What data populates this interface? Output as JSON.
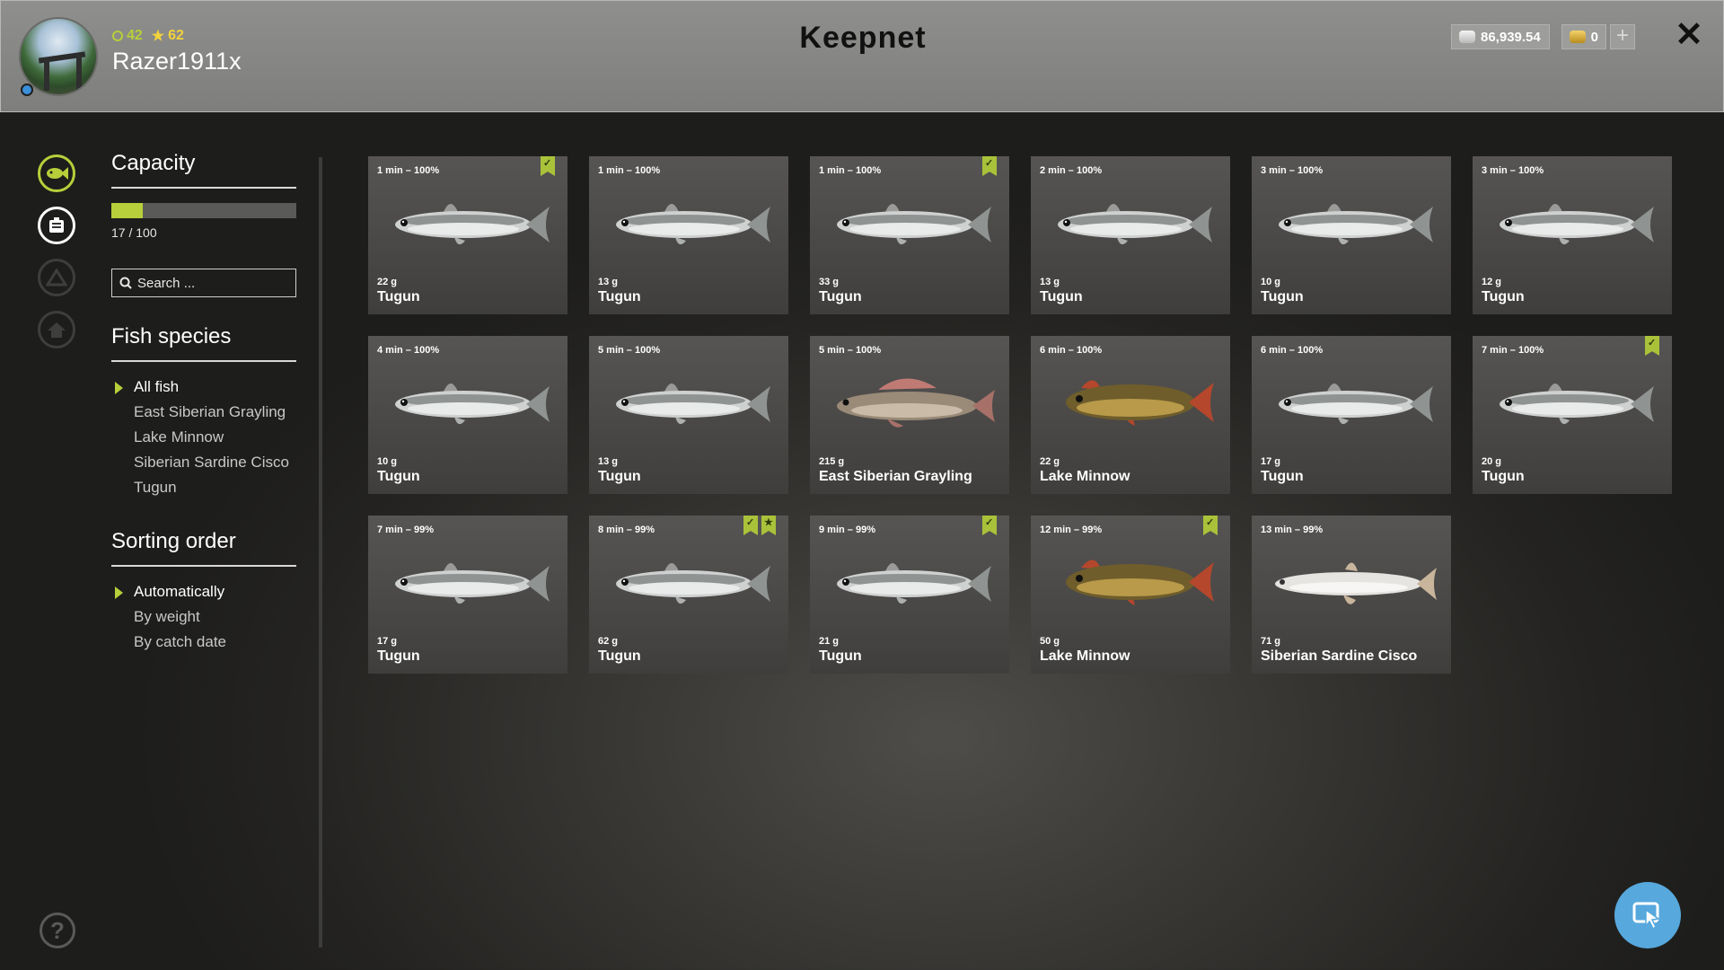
{
  "header": {
    "title": "Keepnet",
    "player": {
      "name": "Razer1911x",
      "level": "42",
      "rank": "62"
    },
    "currency": {
      "silver": "86,939.54",
      "gold": "0"
    },
    "plus_label": "+",
    "close_label": "✕"
  },
  "sidebar": {
    "capacity": {
      "title": "Capacity",
      "used": 17,
      "total": 100,
      "text": "17 / 100",
      "fill_fraction": 0.17
    },
    "search": {
      "placeholder": "Search ..."
    },
    "fish_species": {
      "title": "Fish species",
      "options": [
        "All fish",
        "East Siberian Grayling",
        "Lake Minnow",
        "Siberian Sardine Cisco",
        "Tugun"
      ],
      "selected": "All fish"
    },
    "sorting": {
      "title": "Sorting order",
      "options": [
        "Automatically",
        "By weight",
        "By catch date"
      ],
      "selected": "Automatically"
    }
  },
  "help_label": "?",
  "colors": {
    "accent": "#b7cf3a",
    "flag": "#a9c23a",
    "cursor_button": "#57a8dd"
  },
  "fish": [
    {
      "time": "1 min – 100%",
      "weight": "22 g",
      "name": "Tugun",
      "kind": "tugun",
      "flags": [
        "check"
      ]
    },
    {
      "time": "1 min – 100%",
      "weight": "13 g",
      "name": "Tugun",
      "kind": "tugun",
      "flags": []
    },
    {
      "time": "1 min – 100%",
      "weight": "33 g",
      "name": "Tugun",
      "kind": "tugun",
      "flags": [
        "check"
      ]
    },
    {
      "time": "2 min – 100%",
      "weight": "13 g",
      "name": "Tugun",
      "kind": "tugun",
      "flags": []
    },
    {
      "time": "3 min – 100%",
      "weight": "10 g",
      "name": "Tugun",
      "kind": "tugun",
      "flags": []
    },
    {
      "time": "3 min – 100%",
      "weight": "12 g",
      "name": "Tugun",
      "kind": "tugun",
      "flags": []
    },
    {
      "time": "4 min – 100%",
      "weight": "10 g",
      "name": "Tugun",
      "kind": "tugun",
      "flags": []
    },
    {
      "time": "5 min – 100%",
      "weight": "13 g",
      "name": "Tugun",
      "kind": "tugun",
      "flags": []
    },
    {
      "time": "5 min – 100%",
      "weight": "215 g",
      "name": "East Siberian Grayling",
      "kind": "grayling",
      "flags": []
    },
    {
      "time": "6 min – 100%",
      "weight": "22 g",
      "name": "Lake Minnow",
      "kind": "minnow",
      "flags": []
    },
    {
      "time": "6 min – 100%",
      "weight": "17 g",
      "name": "Tugun",
      "kind": "tugun",
      "flags": []
    },
    {
      "time": "7 min – 100%",
      "weight": "20 g",
      "name": "Tugun",
      "kind": "tugun",
      "flags": [
        "check"
      ]
    },
    {
      "time": "7 min – 99%",
      "weight": "17 g",
      "name": "Tugun",
      "kind": "tugun",
      "flags": []
    },
    {
      "time": "8 min – 99%",
      "weight": "62 g",
      "name": "Tugun",
      "kind": "tugun",
      "flags": [
        "check",
        "star"
      ]
    },
    {
      "time": "9 min – 99%",
      "weight": "21 g",
      "name": "Tugun",
      "kind": "tugun",
      "flags": [
        "check"
      ]
    },
    {
      "time": "12 min – 99%",
      "weight": "50 g",
      "name": "Lake Minnow",
      "kind": "minnow",
      "flags": [
        "check"
      ]
    },
    {
      "time": "13 min – 99%",
      "weight": "71 g",
      "name": "Siberian Sardine Cisco",
      "kind": "cisco",
      "flags": []
    }
  ]
}
